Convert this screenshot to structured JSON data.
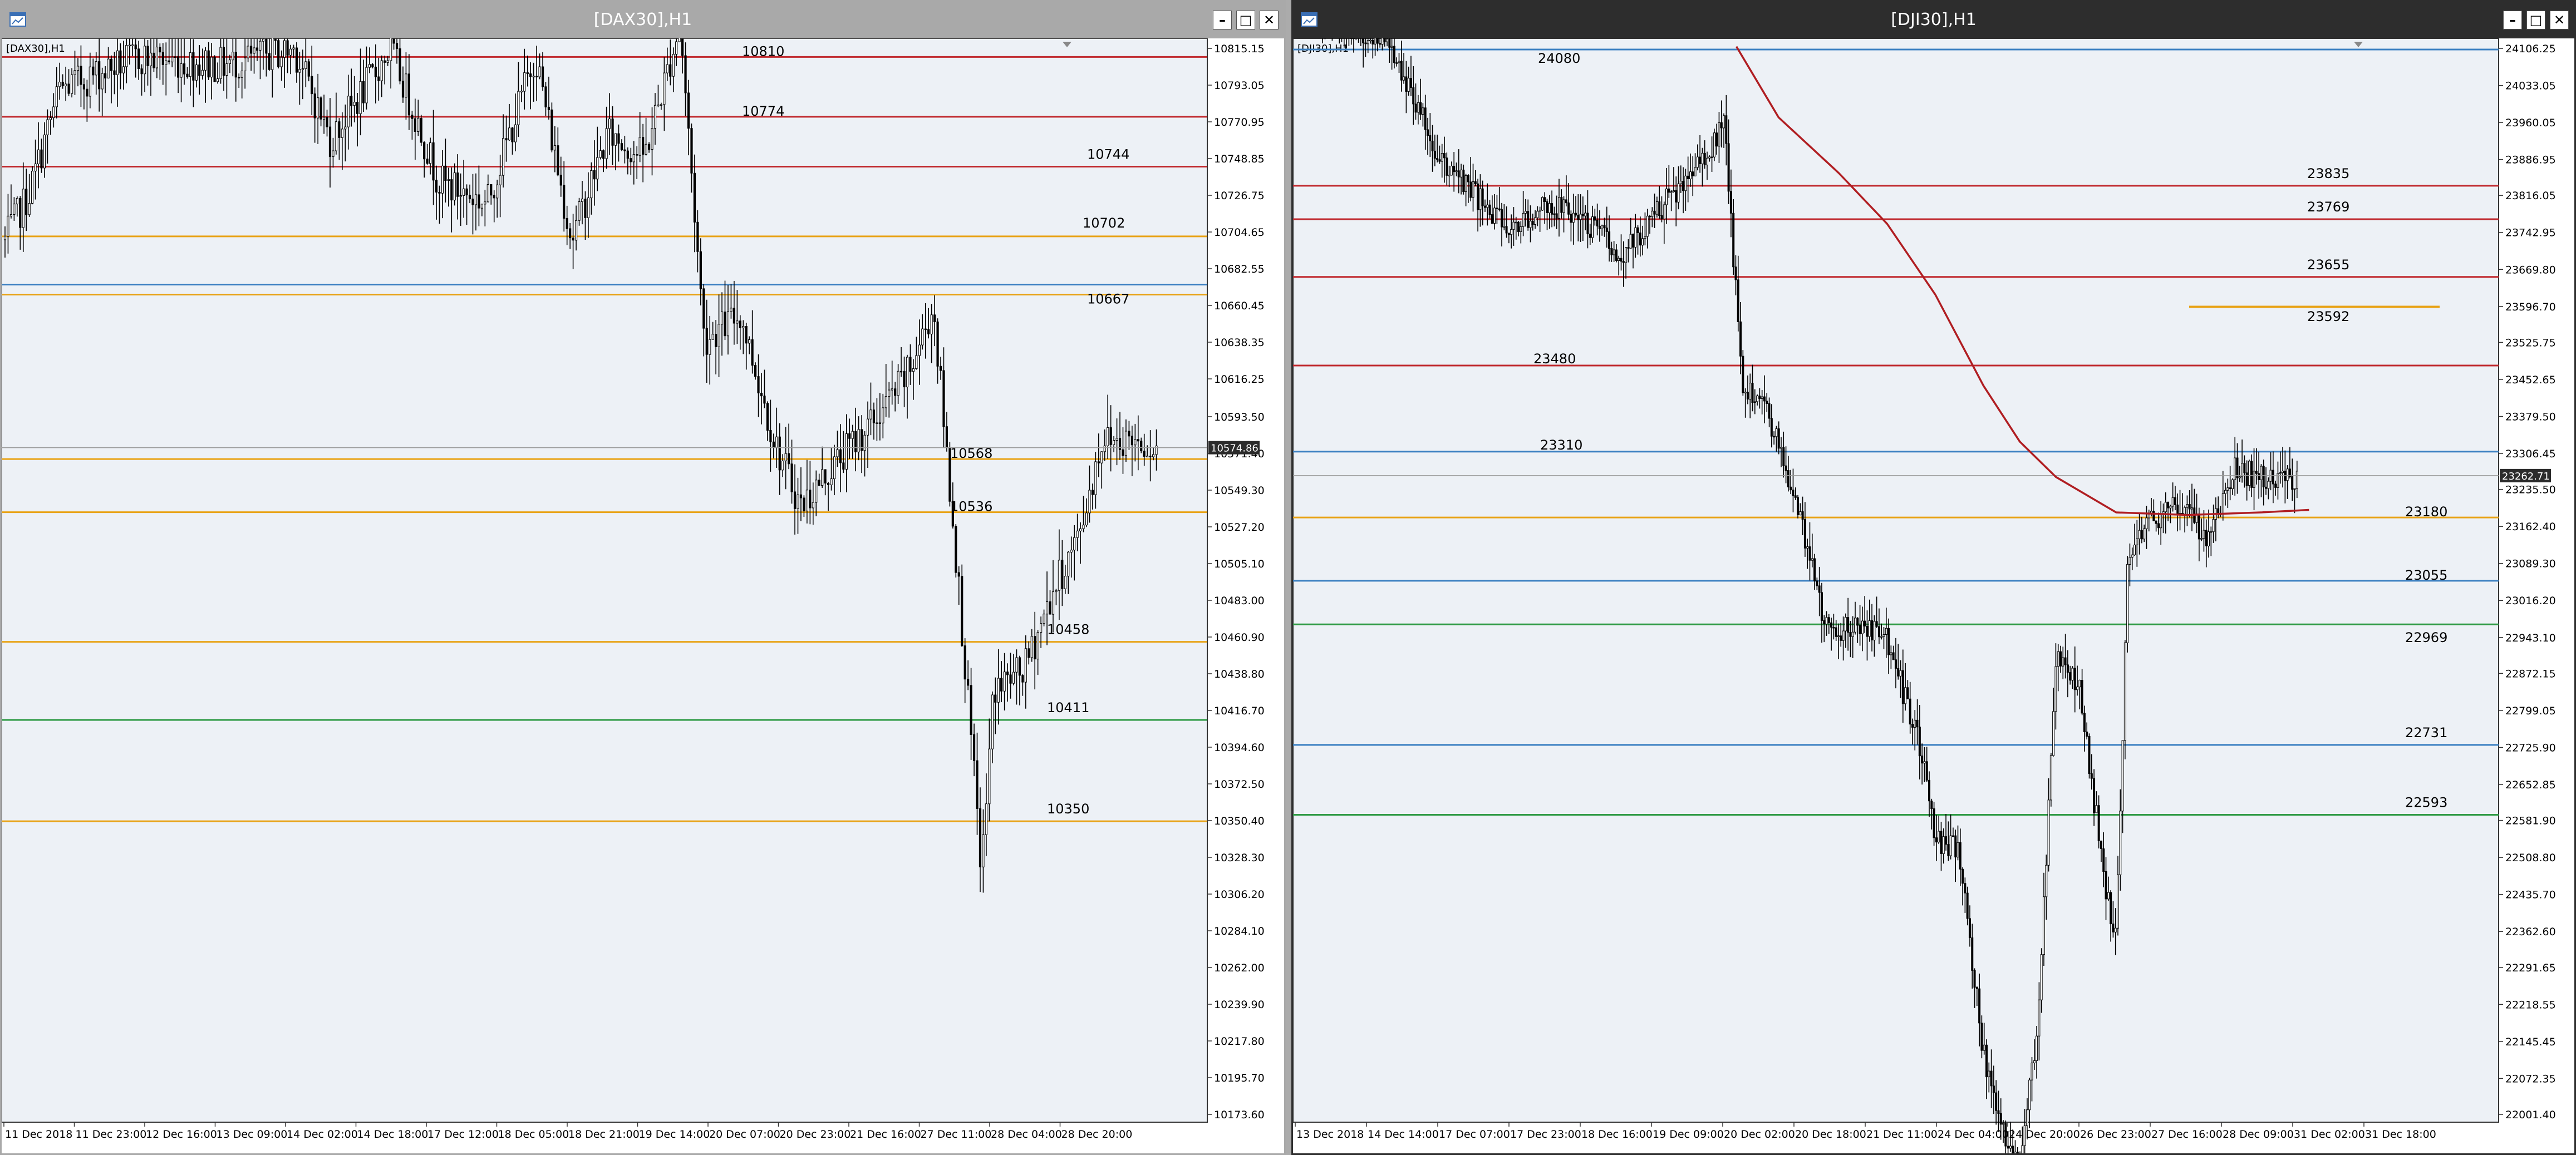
{
  "windows": [
    {
      "id": "dax",
      "title": "[DAX30],H1",
      "symbol_label": "[DAX30],H1",
      "current_price": "10574.86",
      "y_ticks": [
        "10815.15",
        "10793.05",
        "10770.95",
        "10748.85",
        "10726.75",
        "10704.65",
        "10682.55",
        "10660.45",
        "10638.35",
        "10616.25",
        "10593.50",
        "10571.40",
        "10549.30",
        "10527.20",
        "10505.10",
        "10483.00",
        "10460.90",
        "10438.80",
        "10416.70",
        "10394.60",
        "10372.50",
        "10350.40",
        "10328.30",
        "10306.20",
        "10284.10",
        "10262.00",
        "10239.90",
        "10217.80",
        "10195.70",
        "10173.60"
      ],
      "x_ticks": [
        "11 Dec 2018",
        "11 Dec 23:00",
        "12 Dec 16:00",
        "13 Dec 09:00",
        "14 Dec 02:00",
        "14 Dec 18:00",
        "17 Dec 12:00",
        "18 Dec 05:00",
        "18 Dec 21:00",
        "19 Dec 14:00",
        "20 Dec 07:00",
        "20 Dec 23:00",
        "21 Dec 16:00",
        "27 Dec 11:00",
        "28 Dec 04:00",
        "28 Dec 20:00"
      ],
      "levels": [
        {
          "label": "10810",
          "value": 10810,
          "color": "#c0282d"
        },
        {
          "label": "10774",
          "value": 10774,
          "color": "#c0282d"
        },
        {
          "label": "10744",
          "value": 10744,
          "color": "#c0282d"
        },
        {
          "label": "10702",
          "value": 10702,
          "color": "#e8a317"
        },
        {
          "label": "",
          "value": 10673,
          "color": "#3a7fc1"
        },
        {
          "label": "10667",
          "value": 10667,
          "color": "#e8a317"
        },
        {
          "label": "10568",
          "value": 10568,
          "color": "#e8a317"
        },
        {
          "label": "10536",
          "value": 10536,
          "color": "#e8a317"
        },
        {
          "label": "10458",
          "value": 10458,
          "color": "#e8a317"
        },
        {
          "label": "10411",
          "value": 10411,
          "color": "#2e9a44"
        },
        {
          "label": "10350",
          "value": 10350,
          "color": "#e8a317"
        }
      ]
    },
    {
      "id": "dji",
      "title": "[DJI30],H1",
      "symbol_label": "[DJI30],H1",
      "current_price": "23262.71",
      "y_ticks": [
        "24106.25",
        "24033.05",
        "23960.05",
        "23886.95",
        "23816.05",
        "23742.95",
        "23669.80",
        "23596.70",
        "23525.75",
        "23452.65",
        "23379.50",
        "23306.45",
        "23235.50",
        "23162.40",
        "23089.30",
        "23016.20",
        "22943.10",
        "22872.15",
        "22799.05",
        "22725.90",
        "22652.85",
        "22581.90",
        "22508.80",
        "22435.70",
        "22362.60",
        "22291.65",
        "22218.55",
        "22145.45",
        "22072.35",
        "22001.40"
      ],
      "x_ticks": [
        "13 Dec 2018",
        "14 Dec 14:00",
        "17 Dec 07:00",
        "17 Dec 23:00",
        "18 Dec 16:00",
        "19 Dec 09:00",
        "20 Dec 02:00",
        "20 Dec 18:00",
        "21 Dec 11:00",
        "24 Dec 04:00",
        "24 Dec 20:00",
        "26 Dec 23:00",
        "27 Dec 16:00",
        "28 Dec 09:00",
        "31 Dec 02:00",
        "31 Dec 18:00"
      ],
      "levels": [
        {
          "label": "",
          "value": 24104,
          "color": "#3a7fc1"
        },
        {
          "label": "23835",
          "value": 23835,
          "color": "#c0282d"
        },
        {
          "label": "23769",
          "value": 23769,
          "color": "#c0282d"
        },
        {
          "label": "23655",
          "value": 23655,
          "color": "#c0282d"
        },
        {
          "label": "",
          "value": 23480,
          "color": "#c0282d"
        },
        {
          "label": "",
          "value": 23310,
          "color": "#3a7fc1"
        },
        {
          "label": "23180",
          "value": 23180,
          "color": "#e8a317"
        },
        {
          "label": "23055",
          "value": 23055,
          "color": "#3a7fc1"
        },
        {
          "label": "22969",
          "value": 22969,
          "color": "#2e9a44"
        },
        {
          "label": "22731",
          "value": 22731,
          "color": "#3a7fc1"
        },
        {
          "label": "22593",
          "value": 22593,
          "color": "#2e9a44"
        }
      ],
      "free_labels": [
        {
          "label": "24080",
          "value": 24080,
          "color": "#000000"
        },
        {
          "label": "23480",
          "value": 23480,
          "color": "#000000"
        },
        {
          "label": "23310",
          "value": 23310,
          "color": "#000000"
        },
        {
          "label": "23592",
          "value": 23592,
          "color": "#e8a317"
        }
      ]
    }
  ]
}
